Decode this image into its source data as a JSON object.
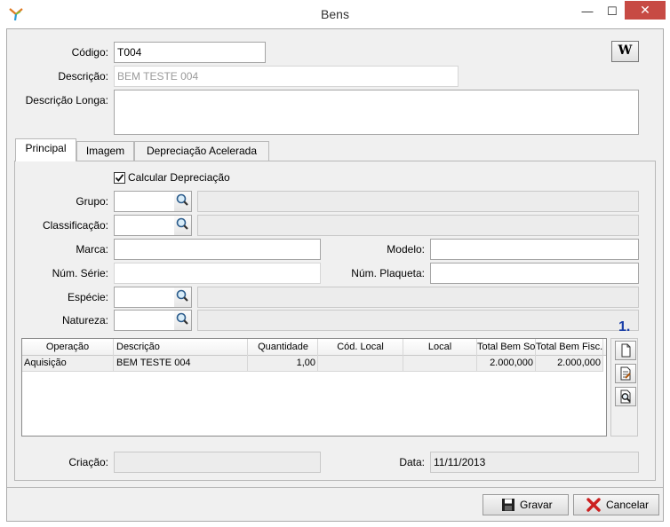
{
  "window": {
    "title": "Bens",
    "minimize": "—",
    "maximize": "☐",
    "close": "✕"
  },
  "toolbar": {
    "w_button": "W"
  },
  "header": {
    "codigo_label": "Código:",
    "codigo_value": "T004",
    "descricao_label": "Descrição:",
    "descricao_value": "BEM TESTE 004",
    "descricao_longa_label": "Descrição Longa:",
    "descricao_longa_value": ""
  },
  "tabs": [
    {
      "label": "Principal",
      "active": true
    },
    {
      "label": "Imagem",
      "active": false
    },
    {
      "label": "Depreciação Acelerada",
      "active": false
    }
  ],
  "principal": {
    "calcular_depreciacao_label": "Calcular Depreciação",
    "calcular_depreciacao_checked": true,
    "grupo_label": "Grupo:",
    "classificacao_label": "Classificação:",
    "marca_label": "Marca:",
    "modelo_label": "Modelo:",
    "num_serie_label": "Núm. Série:",
    "num_plaqueta_label": "Núm. Plaqueta:",
    "especie_label": "Espécie:",
    "natureza_label": "Natureza:",
    "criacao_label": "Criação:",
    "criacao_value": "",
    "data_label": "Data:",
    "data_value": "11/11/2013",
    "step_marker": "1."
  },
  "grid": {
    "columns": [
      "Operação",
      "Descrição",
      "Quantidade",
      "Cód. Local",
      "Local",
      "Total Bem Soc.",
      "Total Bem Fisc."
    ],
    "rows": [
      [
        "Aquisição",
        "BEM TESTE 004",
        "1,00",
        "",
        "",
        "2.000,000",
        "2.000,000"
      ]
    ]
  },
  "buttons": {
    "gravar": "Gravar",
    "cancelar": "Cancelar"
  },
  "colors": {
    "close": "#c74a44",
    "accent_marker": "#1a3fa8"
  }
}
